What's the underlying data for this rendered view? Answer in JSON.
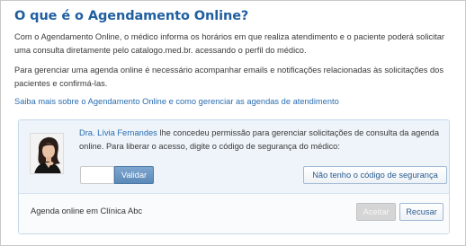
{
  "page": {
    "title": "O que é o Agendamento Online?",
    "paragraph_1": "Com o Agendamento Online, o médico informa os horários em que realiza atendimento e o paciente poderá solicitar uma consulta diretamente pelo catalogo.med.br. acessando o perfil do médico.",
    "paragraph_2": "Para gerenciar uma agenda online é necessário acompanhar emails e notificações relacionadas às solicitações dos pacientes e confirmá-las.",
    "learn_more_link": "Saiba mais sobre o Agendamento Online e como gerenciar as agendas de atendimento"
  },
  "request": {
    "doctor_name": "Dra. Lívia Fernandes",
    "message": " lhe concedeu permissão para gerenciar solicitações de consulta da agenda online. Para liberar o acesso, digite o código de segurança do médico:",
    "code_input_value": "",
    "code_input_placeholder": "",
    "validate_label": "Validar",
    "no_code_label": "Não tenho o código de segurança",
    "clinic_label": "Agenda online em Clínica Abc",
    "accept_label": "Aceitar",
    "accept_disabled": true,
    "decline_label": "Recusar"
  },
  "icons": {
    "avatar": "doctor-avatar-photo"
  },
  "colors": {
    "title": "#1f5fa0",
    "link": "#2a6db0",
    "validate_button": "#6a97c5",
    "panel_background": "#eef4fa",
    "panel_border": "#c5d9ec",
    "disabled_button": "#d5d5d5"
  }
}
